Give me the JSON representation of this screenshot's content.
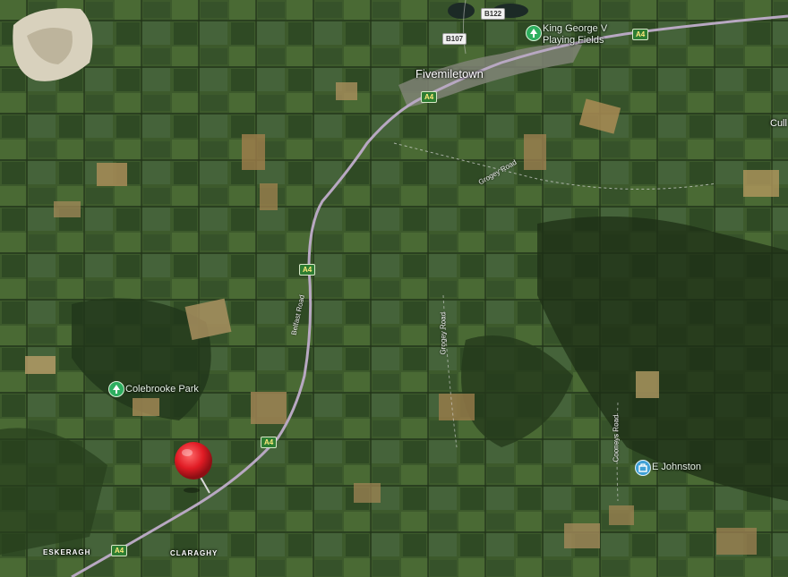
{
  "map": {
    "view": "satellite",
    "labels": {
      "town": "Fivemiletown",
      "park": "Colebrooke Park",
      "playing_fields_line1": "King George V",
      "playing_fields_line2": "Playing Fields",
      "business": "E Johnston",
      "townland_1": "ESKERAGH",
      "townland_2": "CLARAGHY",
      "edge_place": "Cull"
    },
    "roads": {
      "a4": "A4",
      "b107": "B107",
      "b122": "B122",
      "belfast_road": "Belfast Road",
      "grogey_road": "Grogey Road",
      "cooney_road": "Cooneys Road"
    },
    "icons": {
      "park_icon": "tree-icon",
      "fields_icon": "tree-icon",
      "business_icon": "shop-icon",
      "marker_icon": "red-pushpin-icon"
    },
    "colors": {
      "marker": "#e01b24",
      "a_road_shield": "#2e7d32",
      "poi_pin": "#2eae5f",
      "business_pin": "#3fa0d6"
    }
  }
}
